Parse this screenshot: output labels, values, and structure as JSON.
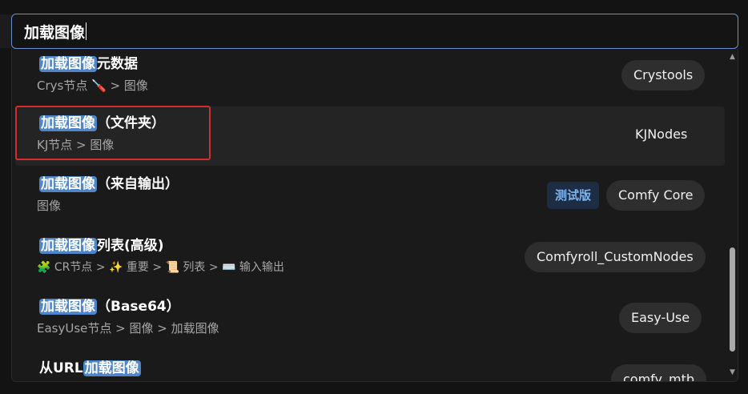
{
  "search": {
    "value": "加载图像"
  },
  "results": [
    {
      "title_highlight": "加载图像",
      "title_rest": "元数据",
      "category": "Crys节点 🪛 > 图像",
      "source": "Crystools"
    },
    {
      "title_highlight": "加载图像",
      "title_rest": "（文件夹）",
      "category": "KJ节点 > 图像",
      "source": "KJNodes"
    },
    {
      "title_highlight": "加载图像",
      "title_rest": "（来自输出）",
      "category": "图像",
      "badge": "测试版",
      "source": "Comfy Core"
    },
    {
      "title_highlight": "加载图像",
      "title_rest": "列表(高级)",
      "category": "🧩 CR节点 > ✨ 重要 > 📜 列表 > ⌨️ 输入输出",
      "source": "Comfyroll_CustomNodes"
    },
    {
      "title_highlight": "加载图像",
      "title_rest": "（Base64）",
      "category": "EasyUse节点 > 图像 > 加载图像",
      "source": "Easy-Use"
    },
    {
      "title_prefix": "从URL",
      "title_highlight": "加载图像",
      "source": "comfy_mtb"
    }
  ],
  "scrollbar": {
    "up_icon": "▲",
    "down_icon": "▼"
  },
  "colors": {
    "highlight": "#4e86c9",
    "focus_border": "#6d8fd6",
    "annotation_box": "#d62b2b",
    "badge_text": "#7fb3f0"
  }
}
